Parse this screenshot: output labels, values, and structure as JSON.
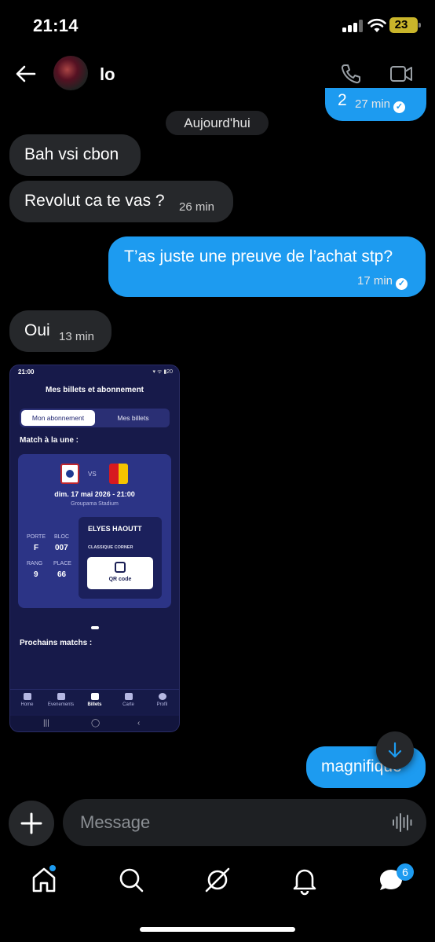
{
  "status_bar": {
    "time": "21:14",
    "battery": "23"
  },
  "header": {
    "contact_name": "lo"
  },
  "day_separator": "Aujourd'hui",
  "messages": [
    {
      "dir": "out",
      "text": "2",
      "time": "27 min"
    },
    {
      "dir": "in",
      "text": "Bah vsi cbon",
      "time": ""
    },
    {
      "dir": "in",
      "text": "Revolut ca te vas ?",
      "time": "26 min"
    },
    {
      "dir": "out",
      "text": "T’as juste une preuve de l’achat stp?",
      "time": "17 min"
    },
    {
      "dir": "in",
      "text": "Oui",
      "time": "13 min"
    },
    {
      "dir": "out",
      "text": "magnifique",
      "time": ""
    }
  ],
  "shared_screenshot": {
    "status_time": "21:00",
    "battery": "20",
    "title": "Mes billets et abonnement",
    "tab_active": "Mon abonnement",
    "tab_inactive": "Mes billets",
    "featured_heading": "Match à la une :",
    "vs": "VS",
    "match_date": "dim. 17 mai 2026 - 21:00",
    "venue": "Groupama Stadium",
    "labels": {
      "porte": "PORTE",
      "bloc": "BLOC",
      "rang": "RANG",
      "place": "PLACE"
    },
    "values": {
      "porte": "F",
      "bloc": "007",
      "rang": "9",
      "place": "66"
    },
    "holder_name": "ELYES HAOUTT",
    "category": "CLASSIQUE CORNER",
    "qr_label": "QR code",
    "upcoming_heading": "Prochains matchs :",
    "tabs": [
      "Home",
      "Evenements",
      "Billets",
      "Carte",
      "Profil"
    ],
    "active_tab": "Billets"
  },
  "composer": {
    "placeholder": "Message"
  },
  "bottom_nav": {
    "messages_badge": "6"
  },
  "colors": {
    "accent": "#1d9bf0",
    "incoming_bubble": "#26282b",
    "ticket_bg": "#171a4a"
  }
}
